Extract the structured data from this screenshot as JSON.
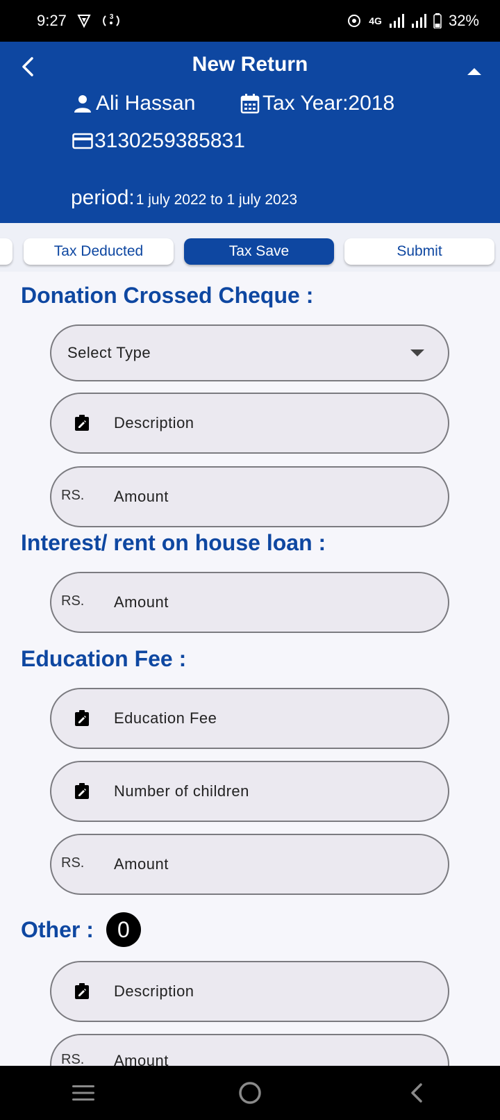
{
  "status_bar": {
    "time": "9:27",
    "network": "4G",
    "battery": "32%",
    "small_badge": "3"
  },
  "header": {
    "title": "New Return",
    "user_name": "Ali Hassan",
    "tax_year": "Tax Year:2018",
    "cnic": "3130259385831",
    "period_label": "period:",
    "period_value": "1 july 2022 to 1 july 2023"
  },
  "tabs": [
    {
      "label": ""
    },
    {
      "label": "Tax Deducted"
    },
    {
      "label": "Tax Save"
    },
    {
      "label": "Submit"
    }
  ],
  "sections": {
    "donation": {
      "title": "Donation Crossed Cheque :",
      "select_placeholder": "Select Type",
      "description_placeholder": "Description",
      "currency": "RS.",
      "amount_placeholder": "Amount"
    },
    "house_loan": {
      "title": "Interest/ rent on house loan :",
      "currency": "RS.",
      "amount_placeholder": "Amount"
    },
    "education": {
      "title": "Education Fee :",
      "fee_placeholder": "Education Fee",
      "children_placeholder": "Number of children",
      "currency": "RS.",
      "amount_placeholder": "Amount"
    },
    "other": {
      "title": "Other :",
      "count": "0",
      "description_placeholder": "Description",
      "currency": "RS.",
      "amount_placeholder": "Amount"
    }
  },
  "colors": {
    "primary": "#0e47a1",
    "field_bg": "#ebe9f0",
    "field_border": "#7b7b80"
  }
}
